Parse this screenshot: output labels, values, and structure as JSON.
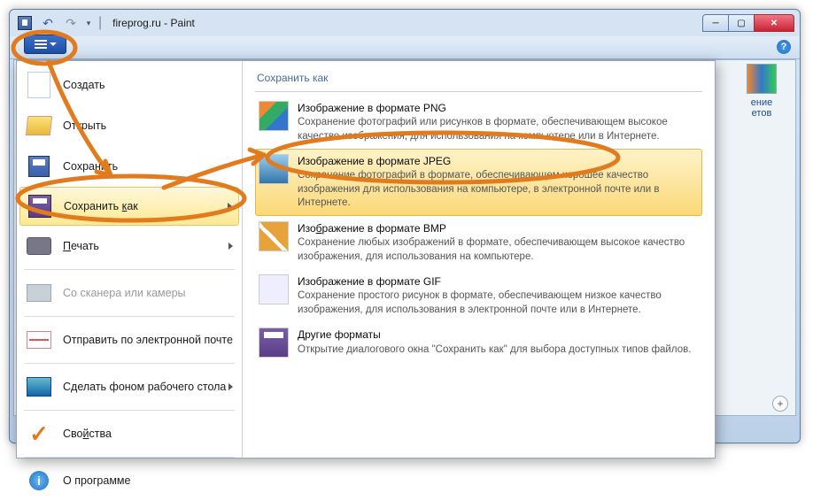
{
  "title": "fireprog.ru - Paint",
  "rightPanel": {
    "line1": "ение",
    "line2": "етов"
  },
  "menu": {
    "items": [
      {
        "label": "Создать"
      },
      {
        "label": "Открыть"
      },
      {
        "label": "Сохранить"
      },
      {
        "saveAs_prefix": "Сохранить ",
        "key": "к",
        "suffix": "ак"
      },
      {
        "print_prefix": "",
        "key": "П",
        "suffix": "ечать"
      },
      {
        "label": "Со сканера или камеры"
      },
      {
        "label": "Отправить по электронной почте"
      },
      {
        "label": "Сделать фоном рабочего стола"
      },
      {
        "props_prefix": "Сво",
        "key": "й",
        "suffix": "ства"
      },
      {
        "label": "О программе"
      }
    ]
  },
  "submenu": {
    "title": "Сохранить как",
    "formats": [
      {
        "title": "Изображение в формате PNG",
        "desc": "Сохранение фотографий или рисунков в формате, обеспечивающем высокое качество изображения, для использования на компьютере или в Интернете."
      },
      {
        "title": "Изображение в формате JPEG",
        "desc": "Сохранение фотографий в формате, обеспечивающем хорошее качество изображения для использования на компьютере, в электронной почте или в Интернете."
      },
      {
        "title_prefix": "Изо",
        "key": "б",
        "title_suffix": "ражение в формате BMP",
        "desc": "Сохранение любых изображений в формате, обеспечивающем высокое качество изображения, для использования на компьютере."
      },
      {
        "title": "Изображение в формате GIF",
        "desc": "Сохранение простого рисунок в формате, обеспечивающем низкое качество изображения, для использования в электронной почте или в Интернете."
      },
      {
        "title": "Другие форматы",
        "desc": "Открытие диалогового окна \"Сохранить как\" для выбора доступных типов файлов."
      }
    ]
  }
}
